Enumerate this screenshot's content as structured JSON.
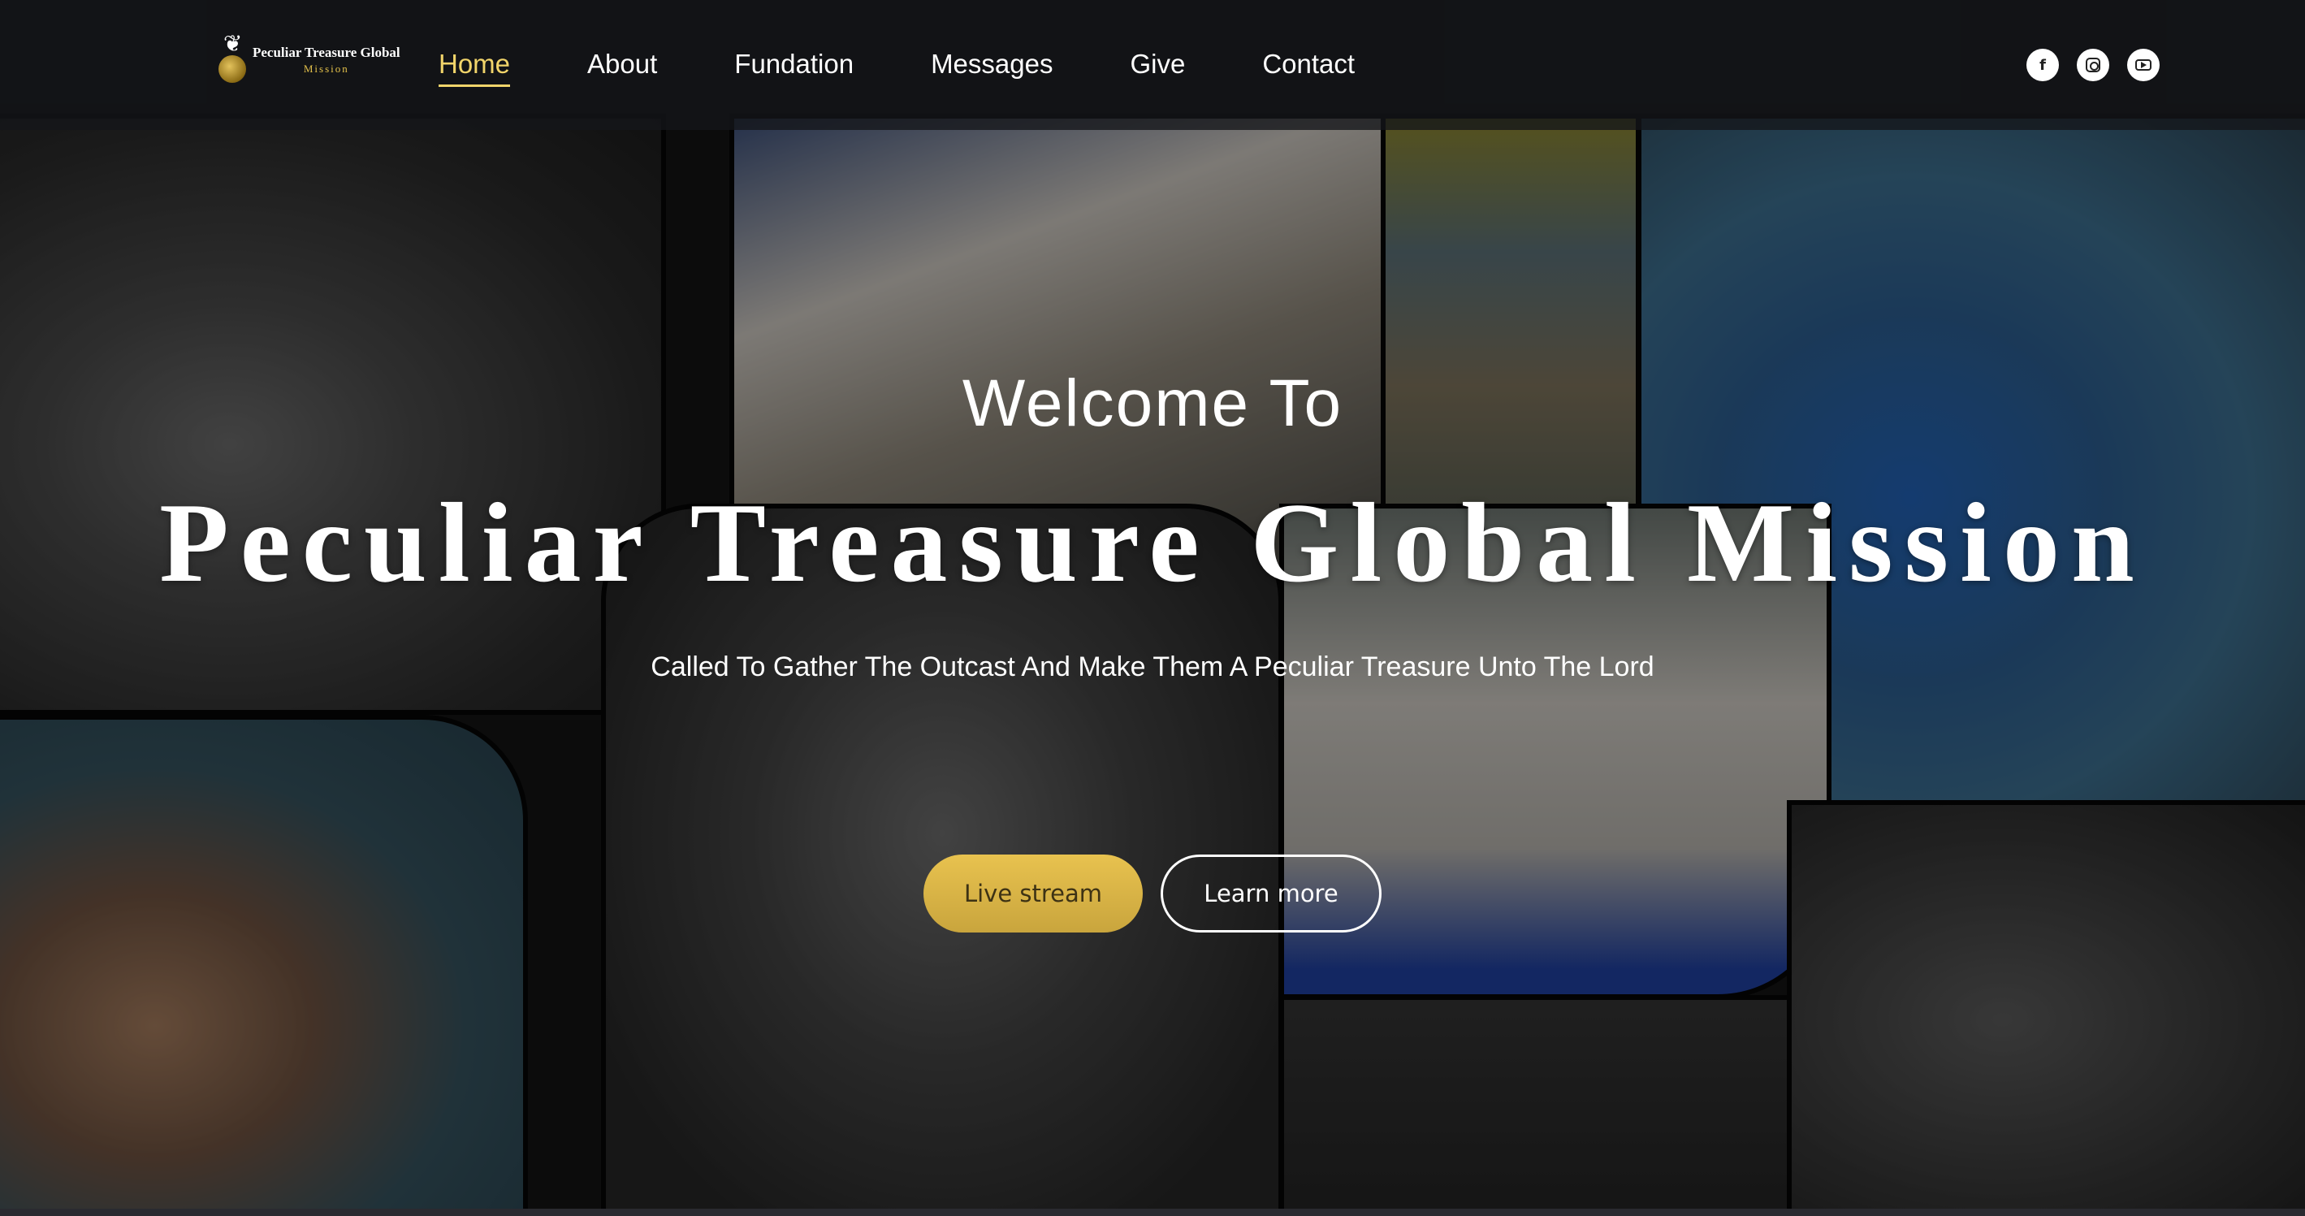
{
  "logo": {
    "name": "Peculiar Treasure Global",
    "sub": "Mission"
  },
  "nav": {
    "items": [
      {
        "label": "Home",
        "active": true
      },
      {
        "label": "About",
        "active": false
      },
      {
        "label": "Fundation",
        "active": false
      },
      {
        "label": "Messages",
        "active": false
      },
      {
        "label": "Give",
        "active": false
      },
      {
        "label": "Contact",
        "active": false
      }
    ]
  },
  "socials": [
    "facebook-icon",
    "instagram-icon",
    "youtube-icon"
  ],
  "hero": {
    "welcome": "Welcome To",
    "title": "Peculiar Treasure Global Mission",
    "tagline": "Called To Gather The Outcast And Make Them A Peculiar Treasure Unto The Lord",
    "primary_button": "Live stream",
    "secondary_button": "Learn more"
  },
  "colors": {
    "accent": "#f1d46a",
    "button_primary": "#dcb848"
  }
}
